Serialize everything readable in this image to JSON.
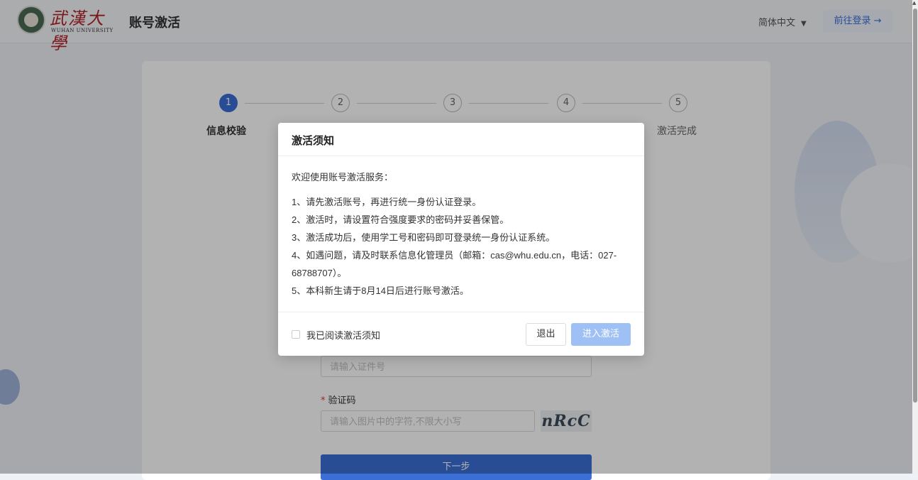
{
  "header": {
    "logo_cn": "武漢大學",
    "logo_en": "WUHAN UNIVERSITY",
    "app_title": "账号激活",
    "language": "简体中文",
    "goto_login": "前往登录 →"
  },
  "steps": [
    {
      "num": "1",
      "label": "信息校验"
    },
    {
      "num": "2",
      "label": ""
    },
    {
      "num": "3",
      "label": ""
    },
    {
      "num": "4",
      "label": ""
    },
    {
      "num": "5",
      "label": "激活完成"
    }
  ],
  "form": {
    "id_placeholder": "请输入证件号",
    "captcha_label": "验证码",
    "captcha_placeholder": "请输入图片中的字符,不限大小写",
    "captcha_text": "nRcC",
    "next_label": "下一步"
  },
  "modal": {
    "title": "激活须知",
    "intro": "欢迎使用账号激活服务：",
    "items": [
      "1、请先激活账号，再进行统一身份认证登录。",
      "2、激活时，请设置符合强度要求的密码并妥善保管。",
      "3、激活成功后，使用学工号和密码即可登录统一身份认证系统。",
      "4、如遇问题，请及时联系信息化管理员（邮箱：cas@whu.edu.cn，电话：027-68788707）。",
      "5、本科新生请于8月14日后进行账号激活。"
    ],
    "checkbox_label": "我已阅读激活须知",
    "exit_label": "退出",
    "enter_label": "进入激活"
  },
  "colors": {
    "primary": "#3b6fd6",
    "primary_disabled": "#9ec0f4",
    "logo_red": "#b3242a"
  }
}
